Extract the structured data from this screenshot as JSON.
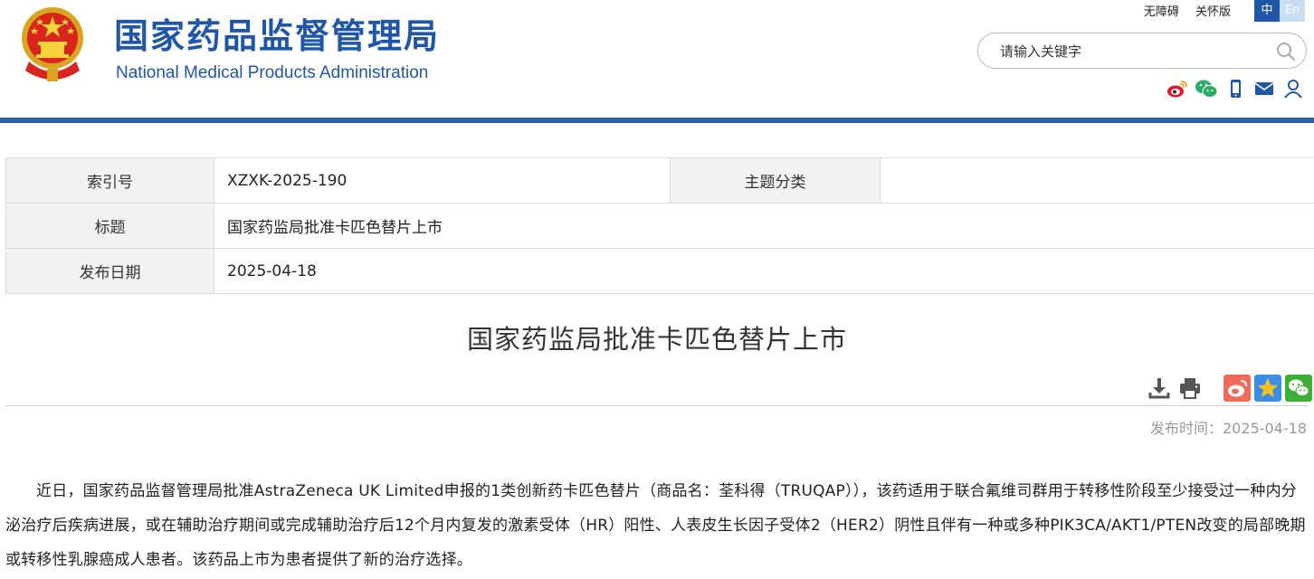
{
  "header": {
    "site_title": "国家药品监督管理局",
    "site_subtitle": "National Medical Products Administration",
    "accessibility_link": "无障碍",
    "care_mode_link": "关怀版",
    "lang_zh": "中",
    "lang_en": "En",
    "search_placeholder": "请输入关键字",
    "brand_color": "#1f56a8",
    "social_icons": [
      "weibo-icon",
      "wechat-icon",
      "mobile-icon",
      "mail-icon",
      "user-icon"
    ]
  },
  "meta": {
    "index_label": "索引号",
    "index_value": "XZXK-2025-190",
    "category_label": "主题分类",
    "category_value": "",
    "title_label": "标题",
    "title_value": "国家药监局批准卡匹色替片上市",
    "date_label": "发布日期",
    "date_value": "2025-04-18"
  },
  "article": {
    "title": "国家药监局批准卡匹色替片上市",
    "publish_time": "发布时间：2025-04-18",
    "body": "近日，国家药品监督管理局批准AstraZeneca UK Limited申报的1类创新药卡匹色替片（商品名：荃科得（TRUQAP）），该药适用于联合氟维司群用于转移性阶段至少接受过一种内分泌治疗后疾病进展，或在辅助治疗期间或完成辅助治疗后12个月内复发的激素受体（HR）阳性、人表皮生长因子受体2（HER2）阴性且伴有一种或多种PIK3CA/AKT1/PTEN改变的局部晚期或转移性乳腺癌成人患者。该药品上市为患者提供了新的治疗选择。",
    "tool_icons": [
      "download-icon",
      "print-icon"
    ],
    "share_icons": [
      "weibo-share-icon",
      "favorite-star-icon",
      "wechat-share-icon"
    ]
  }
}
